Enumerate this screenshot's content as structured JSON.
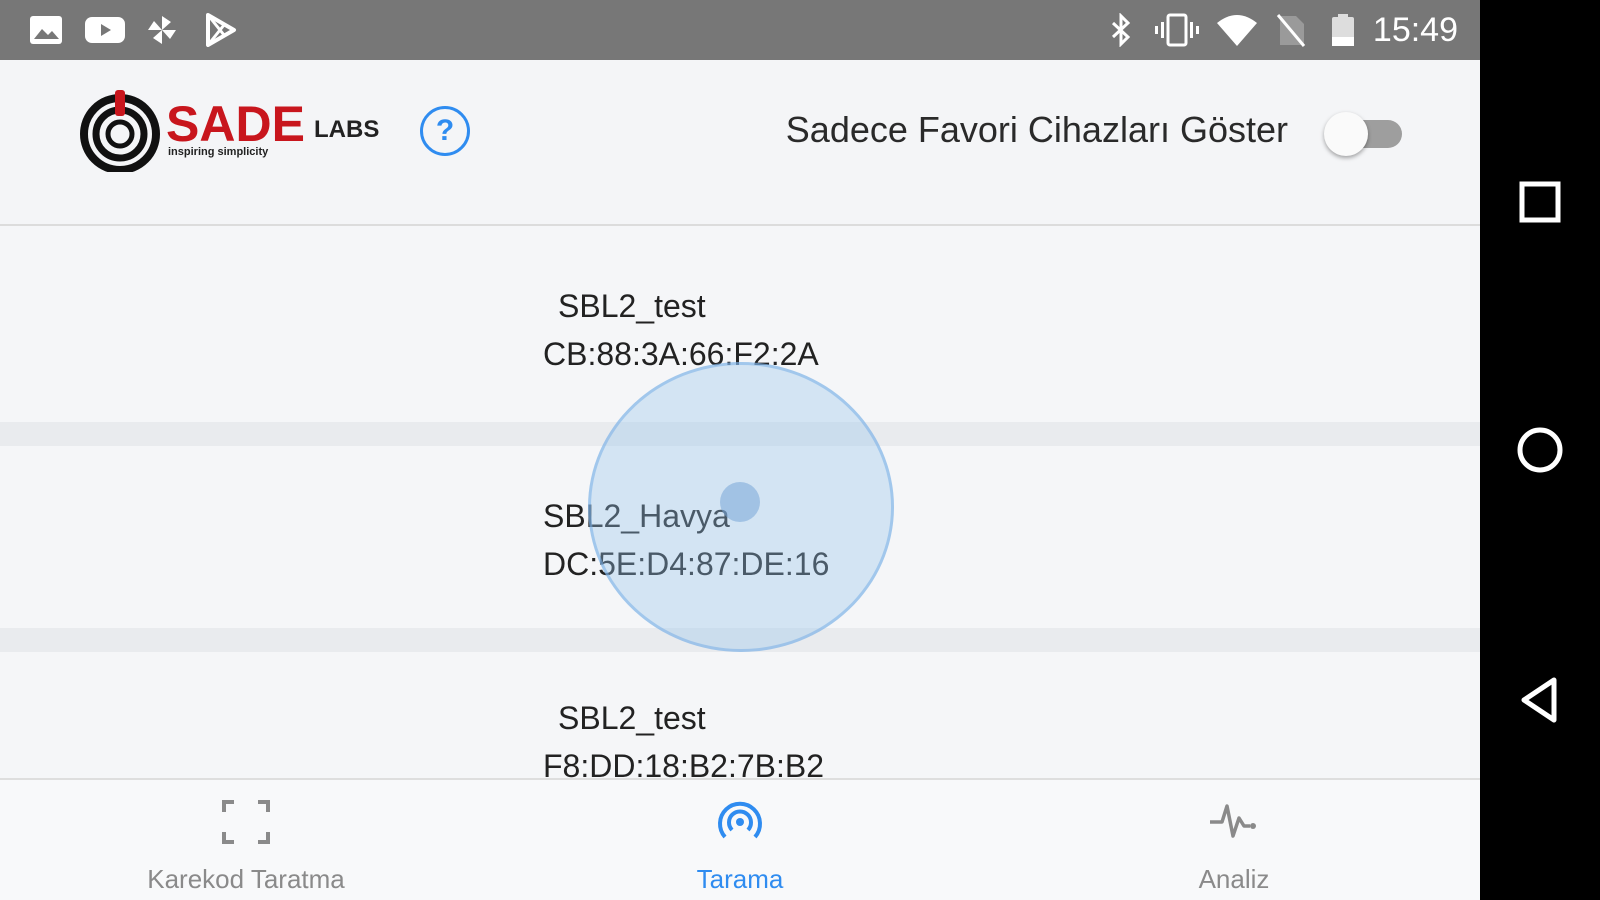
{
  "status_bar": {
    "time": "15:49",
    "left_icons": [
      "image-icon",
      "youtube-icon",
      "pinwheel-icon",
      "play-store-icon"
    ],
    "right_icons": [
      "bluetooth-icon",
      "vibrate-icon",
      "wifi-icon",
      "no-sim-icon",
      "battery-icon"
    ]
  },
  "header": {
    "logo": {
      "brand": "SADE",
      "suffix": "LABS",
      "tagline": "inspiring simplicity"
    },
    "help_label": "?",
    "favorites_label": "Sadece Favori Cihazları Göster",
    "favorites_toggle_on": false
  },
  "devices": [
    {
      "name": "SBL2_test",
      "address": "CB:88:3A:66:F2:2A"
    },
    {
      "name": "SBL2_Havya",
      "address": "DC:5E:D4:87:DE:16"
    },
    {
      "name": "SBL2_test",
      "address": "F8:DD:18:B2:7B:B2"
    }
  ],
  "tabs": [
    {
      "label": "Karekod Taratma",
      "icon": "qr-scan-icon",
      "active": false
    },
    {
      "label": "Tarama",
      "icon": "radar-icon",
      "active": true
    },
    {
      "label": "Analiz",
      "icon": "pulse-icon",
      "active": false
    }
  ],
  "colors": {
    "accent": "#2f8cf0",
    "brand_red": "#c8161d",
    "status_bar": "#777777",
    "inactive_tab": "#8a8a8a"
  },
  "nav_buttons": [
    "recents-icon",
    "home-icon",
    "back-icon"
  ]
}
